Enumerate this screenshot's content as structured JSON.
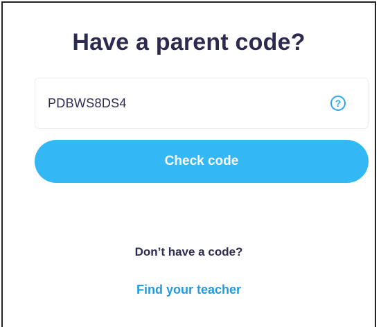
{
  "heading": "Have a parent code?",
  "code_field": {
    "value": "PDBWS8DS4",
    "help_icon": "question-circle-icon",
    "help_glyph": "?"
  },
  "check_button_label": "Check code",
  "no_code_text": "Don’t have a code?",
  "find_teacher_link": "Find your teacher",
  "colors": {
    "heading": "#2c2a50",
    "accent": "#34b7f5",
    "link": "#1e9be3"
  }
}
